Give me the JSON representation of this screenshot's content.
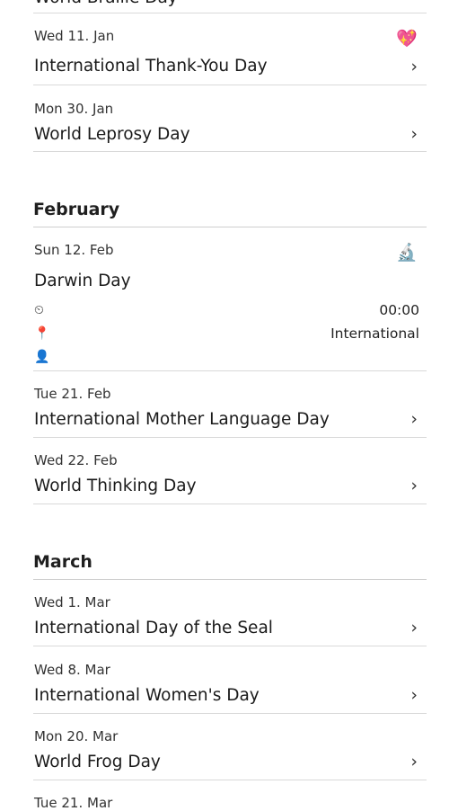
{
  "top_partial_title": "World Braille Day",
  "january_items": [
    {
      "date": "Wed 11. Jan",
      "title": "International Thank-You Day",
      "emoji": "💖"
    },
    {
      "date": "Mon 30. Jan",
      "title": "World Leprosy Day"
    }
  ],
  "february": {
    "heading": "February",
    "expanded": {
      "date": "Sun 12. Feb",
      "title": "Darwin Day",
      "emoji": "🔬",
      "time": "00:00",
      "scope": "International"
    },
    "items": [
      {
        "date": "Tue 21. Feb",
        "title": "International Mother Language Day"
      },
      {
        "date": "Wed 22. Feb",
        "title": "World Thinking Day"
      }
    ]
  },
  "march": {
    "heading": "March",
    "items": [
      {
        "date": "Wed 1. Mar",
        "title": "International Day of the Seal"
      },
      {
        "date": "Wed 8. Mar",
        "title": "International Women's Day"
      },
      {
        "date": "Mon 20. Mar",
        "title": "World Frog Day"
      },
      {
        "date": "Tue 21. Mar",
        "title": ""
      }
    ]
  },
  "icons": {
    "chevron": "›",
    "clock": "⏲",
    "pin": "📍",
    "person": "👤"
  }
}
